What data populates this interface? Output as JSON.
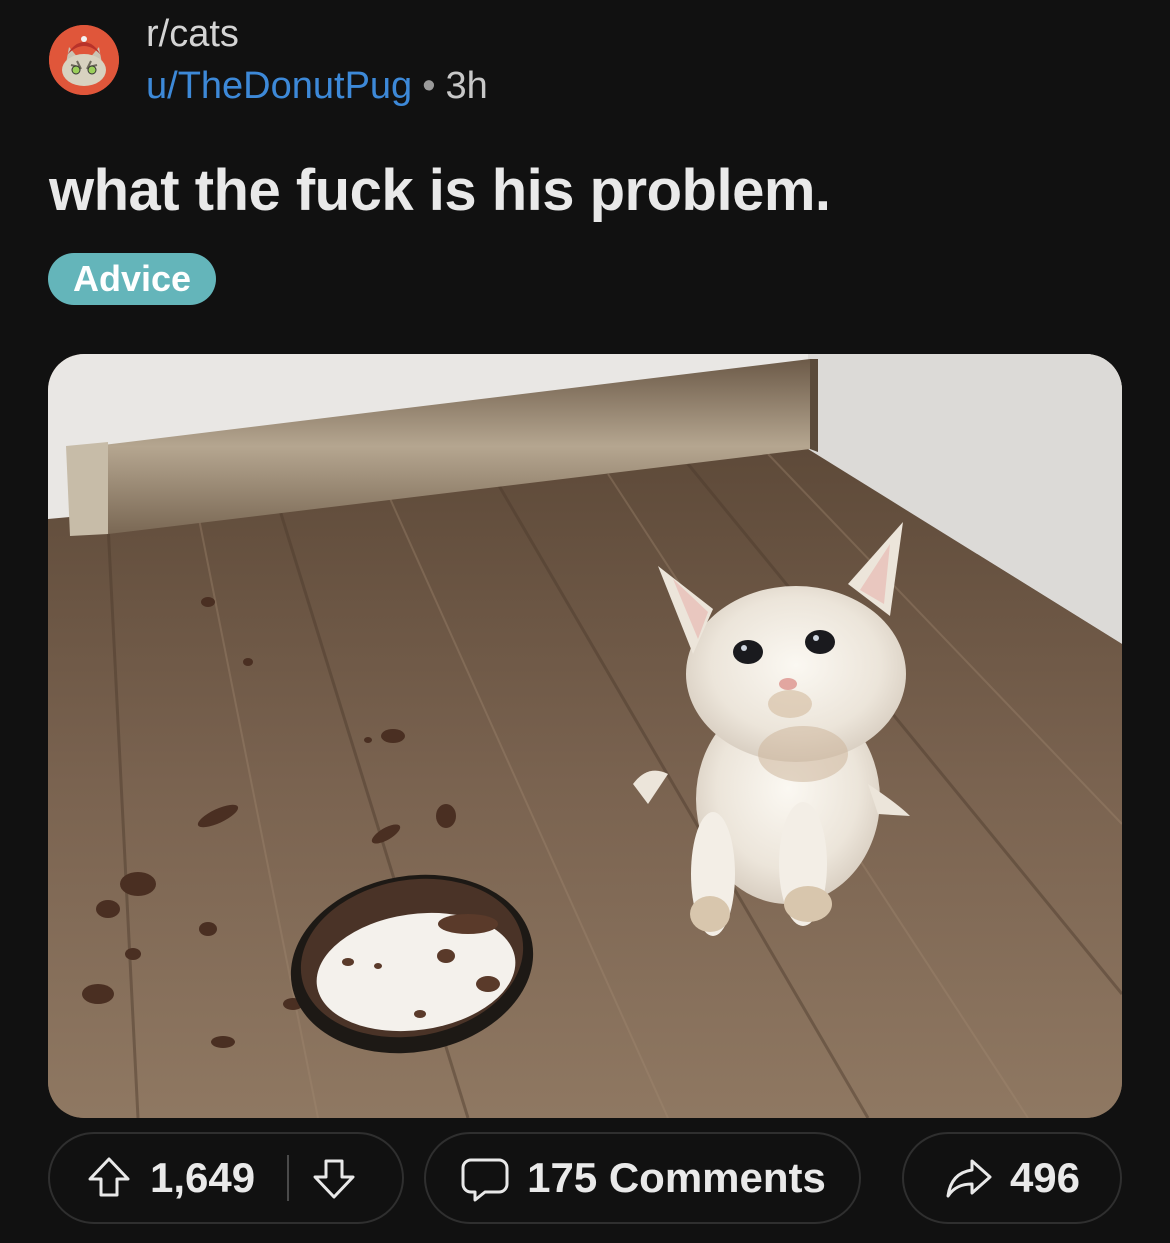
{
  "post": {
    "subreddit": "r/cats",
    "username": "u/TheDonutPug",
    "separator": "•",
    "age": "3h",
    "title": "what the fuck is his problem.",
    "flair": "Advice"
  },
  "actions": {
    "upvotes": "1,649",
    "comments_label": "175 Comments",
    "shares": "496"
  },
  "colors": {
    "background": "#111111",
    "username": "#3d89d8",
    "flair_bg": "#64b5ba",
    "avatar_bg": "#e0563a"
  },
  "icons": [
    "subreddit-avatar-icon",
    "upvote-arrow-icon",
    "downvote-arrow-icon",
    "comment-bubble-icon",
    "share-arrow-icon"
  ]
}
